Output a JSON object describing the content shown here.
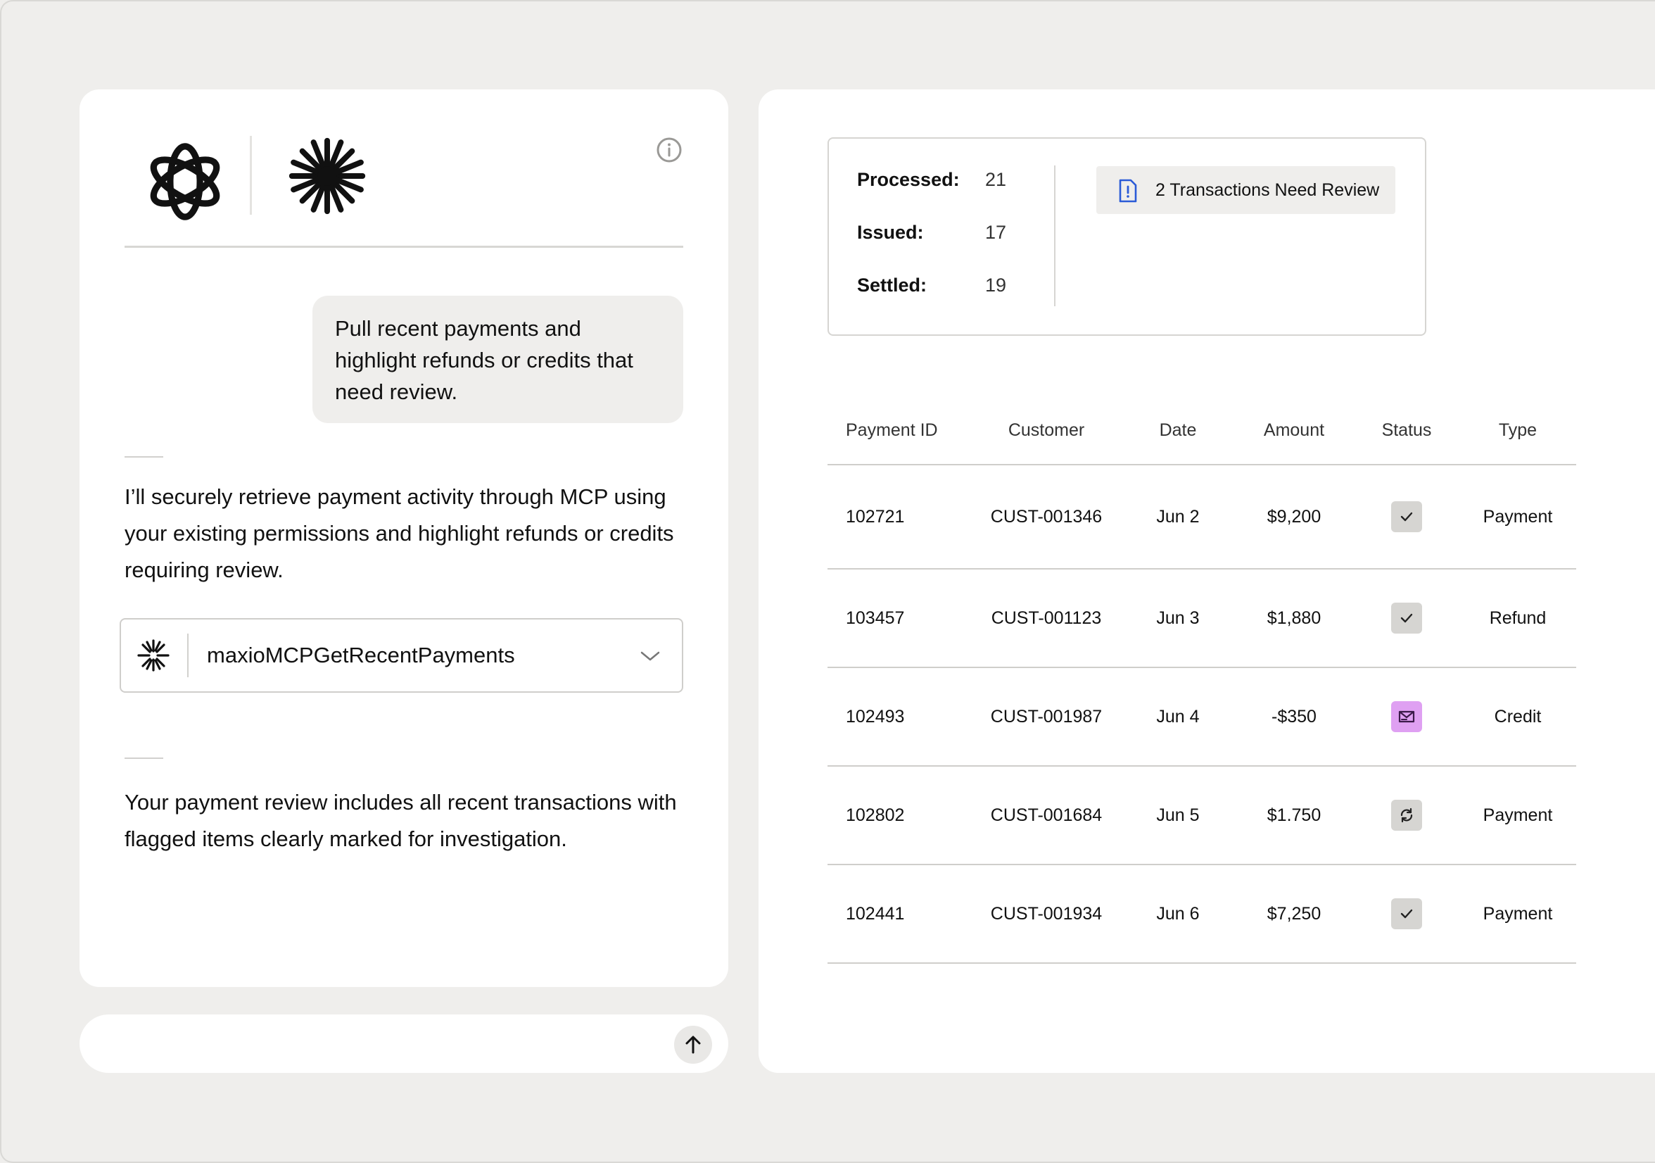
{
  "chat": {
    "user_message": "Pull recent payments and highlight refunds or credits that need review.",
    "assistant_message_1": "I’ll securely retrieve payment activity through MCP using your existing permissions and highlight refunds or credits requiring review.",
    "tool_call": {
      "name": "maxioMCPGetRecentPayments",
      "icon": "asterisk-logo-icon"
    },
    "assistant_message_2": "Your payment review includes all recent transactions with flagged items clearly marked for investigation.",
    "input": {
      "value": "",
      "placeholder": ""
    }
  },
  "summary": {
    "stats": [
      {
        "label": "Processed:",
        "value": "21"
      },
      {
        "label": "Issued:",
        "value": "17"
      },
      {
        "label": "Settled:",
        "value": "19"
      }
    ],
    "review_badge": "2 Transactions Need Review"
  },
  "table": {
    "columns": [
      "Payment ID",
      "Customer",
      "Date",
      "Amount",
      "Status",
      "Type"
    ],
    "rows": [
      {
        "id": "102721",
        "customer": "CUST-001346",
        "date": "Jun 2",
        "amount": "$9,200",
        "status": "check-icon",
        "type": "Payment"
      },
      {
        "id": "103457",
        "customer": "CUST-001123",
        "date": "Jun 3",
        "amount": "$1,880",
        "status": "check-icon",
        "type": "Refund"
      },
      {
        "id": "102493",
        "customer": "CUST-001987",
        "date": "Jun 4",
        "amount": "-$350",
        "status": "flagged-mail-icon",
        "type": "Credit"
      },
      {
        "id": "102802",
        "customer": "CUST-001684",
        "date": "Jun 5",
        "amount": "$1.750",
        "status": "refresh-icon",
        "type": "Payment"
      },
      {
        "id": "102441",
        "customer": "CUST-001934",
        "date": "Jun 6",
        "amount": "$7,250",
        "status": "check-icon",
        "type": "Payment"
      }
    ]
  },
  "colors": {
    "background": "#efeeec",
    "panel": "#ffffff",
    "flag_chip": "#dfa0f2",
    "review_icon": "#2b5bd7",
    "neutral_chip": "#d6d5d2"
  }
}
